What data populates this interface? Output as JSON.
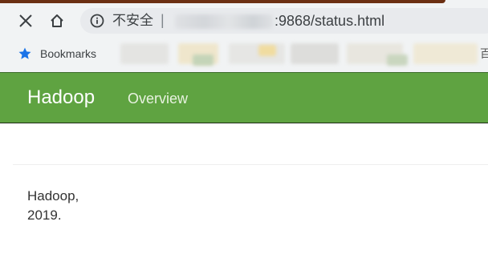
{
  "browser": {
    "security_label": "不安全",
    "separator": "|",
    "url_visible": ":9868/status.html"
  },
  "bookmarks": {
    "label": "Bookmarks",
    "edge_glyph": "百"
  },
  "navbar": {
    "brand": "Hadoop",
    "links": [
      {
        "label": "Overview"
      }
    ],
    "color": "#5fa341"
  },
  "footer": {
    "line1": "Hadoop,",
    "line2": "2019."
  }
}
